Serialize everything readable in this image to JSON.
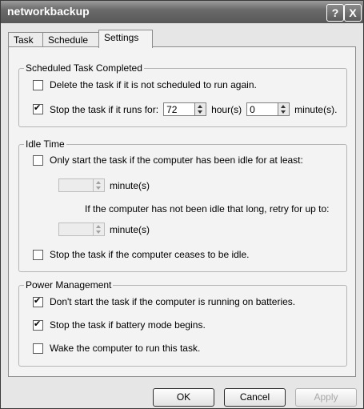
{
  "window": {
    "title": "networkbackup",
    "help_label": "?",
    "close_label": "X"
  },
  "tabs": [
    {
      "label": "Task"
    },
    {
      "label": "Schedule"
    },
    {
      "label": "Settings"
    }
  ],
  "scheduled_group": {
    "title": "Scheduled Task Completed",
    "delete_option": {
      "label": "Delete the task if it is not scheduled to run again.",
      "checked": false
    },
    "stop_option": {
      "label": "Stop the task if it runs for:",
      "checked": true,
      "hours_value": "72",
      "hours_unit": "hour(s)",
      "minutes_value": "0",
      "minutes_unit": "minute(s)."
    }
  },
  "idle_group": {
    "title": "Idle Time",
    "only_start_option": {
      "label": "Only start the task if the computer has been idle for at least:",
      "checked": false
    },
    "idle_minutes_unit": "minute(s)",
    "retry_label": "If the computer has not been idle that long, retry for up to:",
    "retry_minutes_unit": "minute(s)",
    "stop_idle_option": {
      "label": "Stop the task if the computer ceases to be idle.",
      "checked": false
    }
  },
  "power_group": {
    "title": "Power Management",
    "dont_start_batteries": {
      "label": "Don't start the task if the computer is running on batteries.",
      "checked": true
    },
    "stop_battery_mode": {
      "label": "Stop the task if battery mode begins.",
      "checked": true
    },
    "wake_computer": {
      "label": "Wake the computer to run this task.",
      "checked": false
    }
  },
  "buttons": {
    "ok": "OK",
    "cancel": "Cancel",
    "apply": "Apply"
  }
}
